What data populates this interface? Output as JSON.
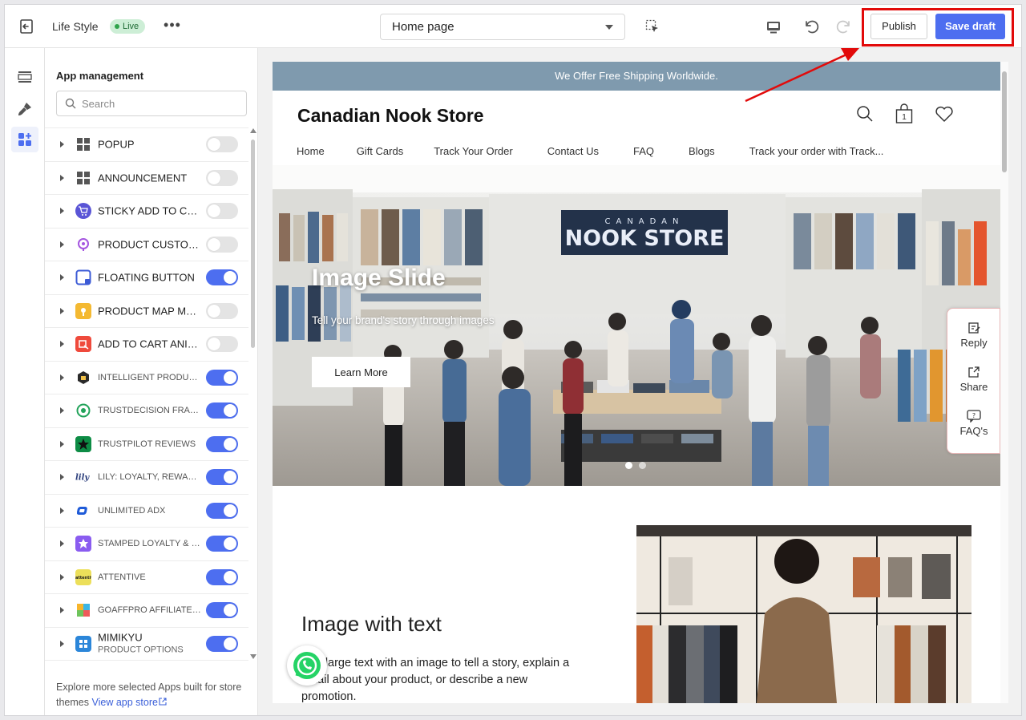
{
  "topbar": {
    "store_name": "Life Style",
    "live_label": "Live",
    "page_select": "Home page",
    "publish_label": "Publish",
    "save_draft_label": "Save draft"
  },
  "panel": {
    "title": "App management",
    "search_placeholder": "Search",
    "apps": [
      {
        "name": "POPUP",
        "on": false,
        "small": false
      },
      {
        "name": "ANNOUNCEMENT",
        "on": false,
        "small": false
      },
      {
        "name": "STICKY ADD TO CART",
        "on": false,
        "small": false
      },
      {
        "name": "PRODUCT CUSTOMIZER",
        "on": false,
        "small": false
      },
      {
        "name": "FLOATING BUTTON",
        "on": true,
        "small": false
      },
      {
        "name": "PRODUCT MAP MARKER",
        "on": false,
        "small": false
      },
      {
        "name": "ADD TO CART ANIMATION",
        "on": false,
        "small": false
      },
      {
        "name": "INTELLIGENT PRODUCT RECOMMENDATIONS",
        "on": true,
        "small": true
      },
      {
        "name": "TRUSTDECISION FRAUD PREVENTION",
        "on": true,
        "small": true
      },
      {
        "name": "TRUSTPILOT REVIEWS",
        "on": true,
        "small": true
      },
      {
        "name": "LILY: LOYALTY, REWARDS, REFERRALS",
        "on": true,
        "small": true
      },
      {
        "name": "UNLIMITED ADX",
        "on": true,
        "small": true
      },
      {
        "name": "STAMPED LOYALTY & REFERRALS",
        "on": true,
        "small": true
      },
      {
        "name": "ATTENTIVE",
        "on": true,
        "small": true
      },
      {
        "name": "GOAFFPRO AFFILIATE MARKETING",
        "on": true,
        "small": true
      },
      {
        "name": "MIMIKYU",
        "sub": "PRODUCT OPTIONS",
        "on": true,
        "small": false
      }
    ],
    "footer_text": "Explore more selected Apps built for store themes",
    "footer_link": "View app store"
  },
  "preview": {
    "banner": "We Offer Free Shipping Worldwide.",
    "store_title": "Canadian Nook Store",
    "cart_count": "1",
    "nav": [
      "Home",
      "Gift Cards",
      "Track Your Order",
      "Contact Us",
      "FAQ",
      "Blogs",
      "Track your order with Track..."
    ],
    "hero_sign": "CANADAN NOOK STORE",
    "hero_title": "Image Slide",
    "hero_subtitle": "Tell your brand's story through images",
    "hero_button": "Learn More",
    "float_buttons": [
      "Reply",
      "Share",
      "FAQ's"
    ],
    "iwt_title": "Image with text",
    "iwt_body": "Pair large text with an image to tell a story, explain a detail about your product, or describe a new promotion."
  },
  "colors": {
    "accent": "#4d6ef0",
    "banner": "#7f9aae",
    "highlight": "#e20a0a"
  }
}
